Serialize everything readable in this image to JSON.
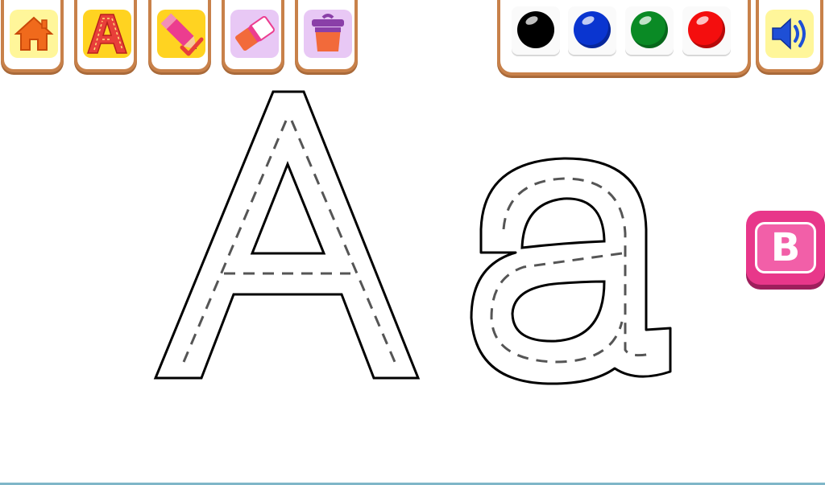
{
  "toolbar": {
    "tools": [
      {
        "id": "home",
        "icon": "home-icon",
        "bg": "#fff69a",
        "color": "#f06a1c"
      },
      {
        "id": "letter-select",
        "label": "A",
        "icon": "letter-a-icon",
        "bg": "#ffd321",
        "color": "#e83f3a"
      },
      {
        "id": "pencil",
        "icon": "pencil-icon",
        "bg": "#ffd321",
        "color": "#ec3d8f"
      },
      {
        "id": "eraser",
        "icon": "eraser-icon",
        "bg": "#e8c8f5",
        "color": "#f26a3a"
      },
      {
        "id": "trash",
        "icon": "trash-icon",
        "bg": "#e8c8f5",
        "color": "#f26a3a"
      }
    ],
    "sound": {
      "icon": "speaker-icon",
      "bg": "#fff69a",
      "color": "#1e4fd6"
    }
  },
  "palette": {
    "colors": [
      {
        "name": "black",
        "hex": "#000000"
      },
      {
        "name": "blue",
        "hex": "#0a35d0"
      },
      {
        "name": "green",
        "hex": "#0a8a25"
      },
      {
        "name": "red",
        "hex": "#f40e0e"
      }
    ]
  },
  "tracing": {
    "uppercase": "A",
    "lowercase": "a"
  },
  "next_letter": {
    "label": "B",
    "color": "#e8378a"
  }
}
